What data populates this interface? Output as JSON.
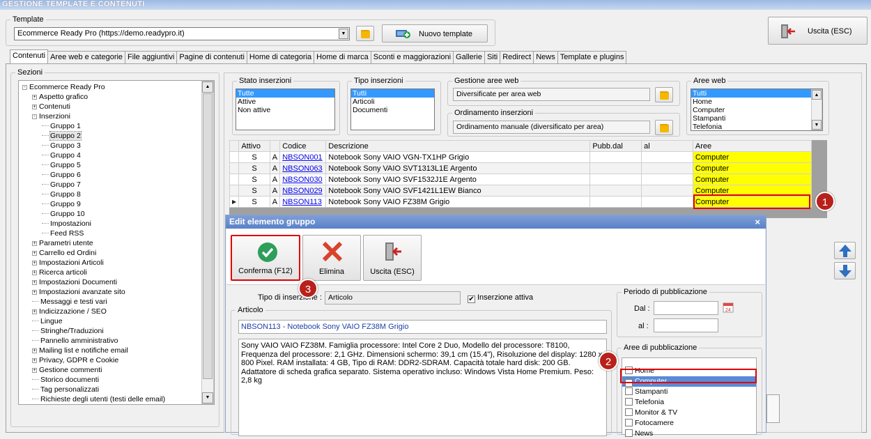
{
  "window": {
    "title": "GESTIONE TEMPLATE E CONTENUTI"
  },
  "template": {
    "legend": "Template",
    "selected": "Ecommerce Ready Pro (https://demo.readypro.it)",
    "new_label": "Nuovo template",
    "exit_label": "Uscita (ESC)"
  },
  "tabs": [
    "Contenuti",
    "Aree web e categorie",
    "File aggiuntivi",
    "Pagine di contenuti",
    "Home di categoria",
    "Home di marca",
    "Sconti e maggiorazioni",
    "Gallerie",
    "Siti",
    "Redirect",
    "News",
    "Template e plugins"
  ],
  "sections": {
    "legend": "Sezioni",
    "tree": [
      {
        "label": "Ecommerce Ready Pro",
        "exp": "-",
        "level": 0
      },
      {
        "label": "Aspetto grafico",
        "exp": "+",
        "level": 1
      },
      {
        "label": "Contenuti",
        "exp": "+",
        "level": 1
      },
      {
        "label": "Inserzioni",
        "exp": "-",
        "level": 1
      },
      {
        "label": "Gruppo 1",
        "exp": "",
        "level": 2
      },
      {
        "label": "Gruppo 2",
        "exp": "",
        "level": 2
      },
      {
        "label": "Gruppo 3",
        "exp": "",
        "level": 2
      },
      {
        "label": "Gruppo 4",
        "exp": "",
        "level": 2
      },
      {
        "label": "Gruppo 5",
        "exp": "",
        "level": 2
      },
      {
        "label": "Gruppo 6",
        "exp": "",
        "level": 2
      },
      {
        "label": "Gruppo 7",
        "exp": "",
        "level": 2
      },
      {
        "label": "Gruppo 8",
        "exp": "",
        "level": 2
      },
      {
        "label": "Gruppo 9",
        "exp": "",
        "level": 2
      },
      {
        "label": "Gruppo 10",
        "exp": "",
        "level": 2
      },
      {
        "label": "Impostazioni",
        "exp": "",
        "level": 2
      },
      {
        "label": "Feed RSS",
        "exp": "",
        "level": 2
      },
      {
        "label": "Parametri utente",
        "exp": "+",
        "level": 1
      },
      {
        "label": "Carrello ed Ordini",
        "exp": "+",
        "level": 1
      },
      {
        "label": "Impostazioni Articoli",
        "exp": "+",
        "level": 1
      },
      {
        "label": "Ricerca articoli",
        "exp": "+",
        "level": 1
      },
      {
        "label": "Impostazioni Documenti",
        "exp": "+",
        "level": 1
      },
      {
        "label": "Impostazioni avanzate sito",
        "exp": "+",
        "level": 1
      },
      {
        "label": "Messaggi e testi vari",
        "exp": "",
        "level": 1
      },
      {
        "label": "Indicizzazione / SEO",
        "exp": "+",
        "level": 1
      },
      {
        "label": "Lingue",
        "exp": "",
        "level": 1
      },
      {
        "label": "Stringhe/Traduzioni",
        "exp": "",
        "level": 1
      },
      {
        "label": "Pannello amministrativo",
        "exp": "",
        "level": 1
      },
      {
        "label": "Mailing list e notifiche email",
        "exp": "+",
        "level": 1
      },
      {
        "label": "Privacy, GDPR e Cookie",
        "exp": "+",
        "level": 1
      },
      {
        "label": "Gestione commenti",
        "exp": "+",
        "level": 1
      },
      {
        "label": "Storico documenti",
        "exp": "",
        "level": 1
      },
      {
        "label": "Tag personalizzati",
        "exp": "",
        "level": 1
      },
      {
        "label": "Richieste degli utenti (testi delle email)",
        "exp": "",
        "level": 1
      }
    ]
  },
  "filters": {
    "stato": {
      "legend": "Stato inserzioni",
      "options": [
        "Tutte",
        "Attive",
        "Non attive"
      ]
    },
    "tipo": {
      "legend": "Tipo inserzioni",
      "options": [
        "Tutti",
        "Articoli",
        "Documenti"
      ]
    },
    "gestione": {
      "legend": "Gestione aree web",
      "value": "Diversificate per area web"
    },
    "ordinamento": {
      "legend": "Ordinamento inserzioni",
      "value": "Ordinamento manuale (diversificato per area)"
    },
    "aree": {
      "legend": "Aree web",
      "options": [
        "Tutti",
        "Home",
        "Computer",
        "Stampanti",
        "Telefonia"
      ]
    }
  },
  "grid": {
    "headers": [
      "Attivo",
      "",
      "Codice",
      "Descrizione",
      "Pubb.dal",
      "al",
      "Aree"
    ],
    "rows": [
      {
        "attivo": "S",
        "tipo": "A",
        "codice": "NBSON001",
        "descrizione": "Notebook Sony VAIO VGN-TX1HP Grigio",
        "dal": "",
        "al": "",
        "aree": "Computer"
      },
      {
        "attivo": "S",
        "tipo": "A",
        "codice": "NBSON063",
        "descrizione": "Notebook Sony VAIO SVT1313L1E Argento",
        "dal": "",
        "al": "",
        "aree": "Computer"
      },
      {
        "attivo": "S",
        "tipo": "A",
        "codice": "NBSON030",
        "descrizione": "Notebook Sony VAIO SVF1532J1E Argento",
        "dal": "",
        "al": "",
        "aree": "Computer"
      },
      {
        "attivo": "S",
        "tipo": "A",
        "codice": "NBSON029",
        "descrizione": "Notebook Sony VAIO SVF1421L1EW Bianco",
        "dal": "",
        "al": "",
        "aree": "Computer"
      },
      {
        "attivo": "S",
        "tipo": "A",
        "codice": "NBSON113",
        "descrizione": "Notebook Sony VAIO FZ38M Grigio",
        "dal": "",
        "al": "",
        "aree": "Computer"
      }
    ]
  },
  "dialog": {
    "title": "Edit elemento gruppo",
    "close": "×",
    "confirm": "Conferma (F12)",
    "delete": "Elimina",
    "exit": "Uscita (ESC)",
    "tipo_label": "Tipo di inserzione :",
    "tipo_value": "Articolo",
    "attiva_label": "Inserzione attiva",
    "articolo_legend": "Articolo",
    "articolo_value": "NBSON113 - Notebook Sony VAIO FZ38M Grigio",
    "descrizione": "Sony VAIO VAIO FZ38M. Famiglia processore: Intel Core 2 Duo, Modello del processore: T8100, Frequenza del processore: 2,1 GHz. Dimensioni schermo: 39,1 cm (15.4\"), Risoluzione del display: 1280 x 800 Pixel. RAM installata: 4 GB, Tipo di RAM: DDR2-SDRAM. Capacità totale hard disk: 200 GB. Adattatore di scheda grafica separato. Sistema operativo incluso: Windows Vista Home Premium. Peso: 2,8 kg",
    "periodo_legend": "Periodo di pubblicazione",
    "dal_label": "Dal :",
    "al_label": "al :",
    "aree_legend": "Aree di pubblicazione",
    "aree": [
      {
        "label": "Home",
        "checked": false
      },
      {
        "label": "Computer",
        "checked": true
      },
      {
        "label": "Stampanti",
        "checked": false
      },
      {
        "label": "Telefonia",
        "checked": false
      },
      {
        "label": "Monitor & TV",
        "checked": false
      },
      {
        "label": "Fotocamere",
        "checked": false
      },
      {
        "label": "News",
        "checked": false
      }
    ]
  },
  "badges": [
    "1",
    "2",
    "3"
  ],
  "colors": {
    "selection": "#3399ff",
    "highlight": "#ffff00",
    "annotation": "#e00000",
    "badge": "#b8201c",
    "confirm": "#2e9e5b",
    "delete": "#d9432b"
  }
}
